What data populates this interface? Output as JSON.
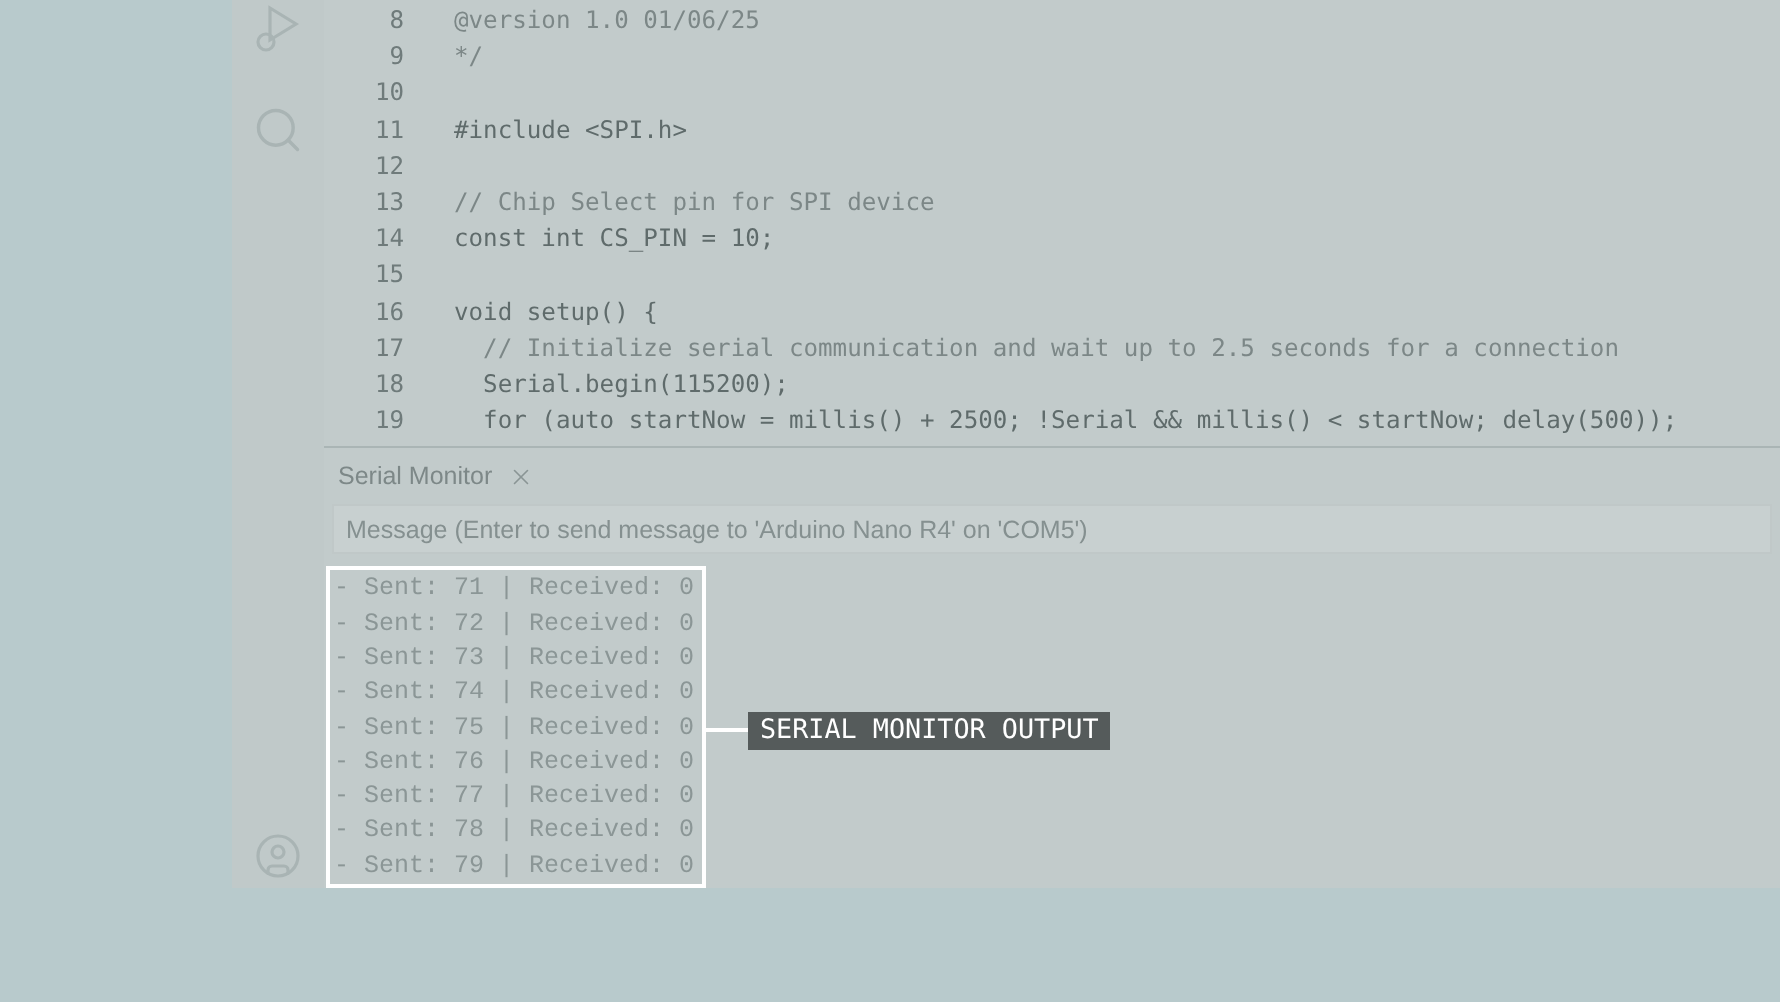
{
  "editor": {
    "lines": [
      {
        "number": "8",
        "text": "@version 1.0 01/06/25",
        "kind": "comment"
      },
      {
        "number": "9",
        "text": "*/",
        "kind": "comment"
      },
      {
        "number": "10"
      },
      {
        "number": "11",
        "text": "#include <SPI.h>",
        "kind": "code"
      },
      {
        "number": "12"
      },
      {
        "number": "13",
        "text": "// Chip Select pin for SPI device",
        "kind": "comment"
      },
      {
        "number": "14",
        "text": "const int CS_PIN = 10;",
        "kind": "code"
      },
      {
        "number": "15"
      },
      {
        "number": "16",
        "text": "void setup() {",
        "kind": "code"
      },
      {
        "number": "17",
        "text": "  // Initialize serial communication and wait up to 2.5 seconds for a connection",
        "kind": "comment"
      },
      {
        "number": "18",
        "text": "  Serial.begin(115200);",
        "kind": "code"
      },
      {
        "number": "19",
        "text": "  for (auto startNow = millis() + 2500; !Serial && millis() < startNow; delay(500));",
        "kind": "code"
      }
    ]
  },
  "serial_monitor": {
    "tab_label": "Serial Monitor",
    "message_field": {
      "placeholder": "Message (Enter to send message to 'Arduino Nano R4' on 'COM5')"
    },
    "output": [
      "- Sent: 71 | Received: 0",
      "- Sent: 72 | Received: 0",
      "- Sent: 73 | Received: 0",
      "- Sent: 74 | Received: 0",
      "- Sent: 75 | Received: 0",
      "- Sent: 76 | Received: 0",
      "- Sent: 77 | Received: 0",
      "- Sent: 78 | Received: 0",
      "- Sent: 79 | Received: 0"
    ]
  },
  "callout": {
    "label": "SERIAL MONITOR OUTPUT"
  }
}
